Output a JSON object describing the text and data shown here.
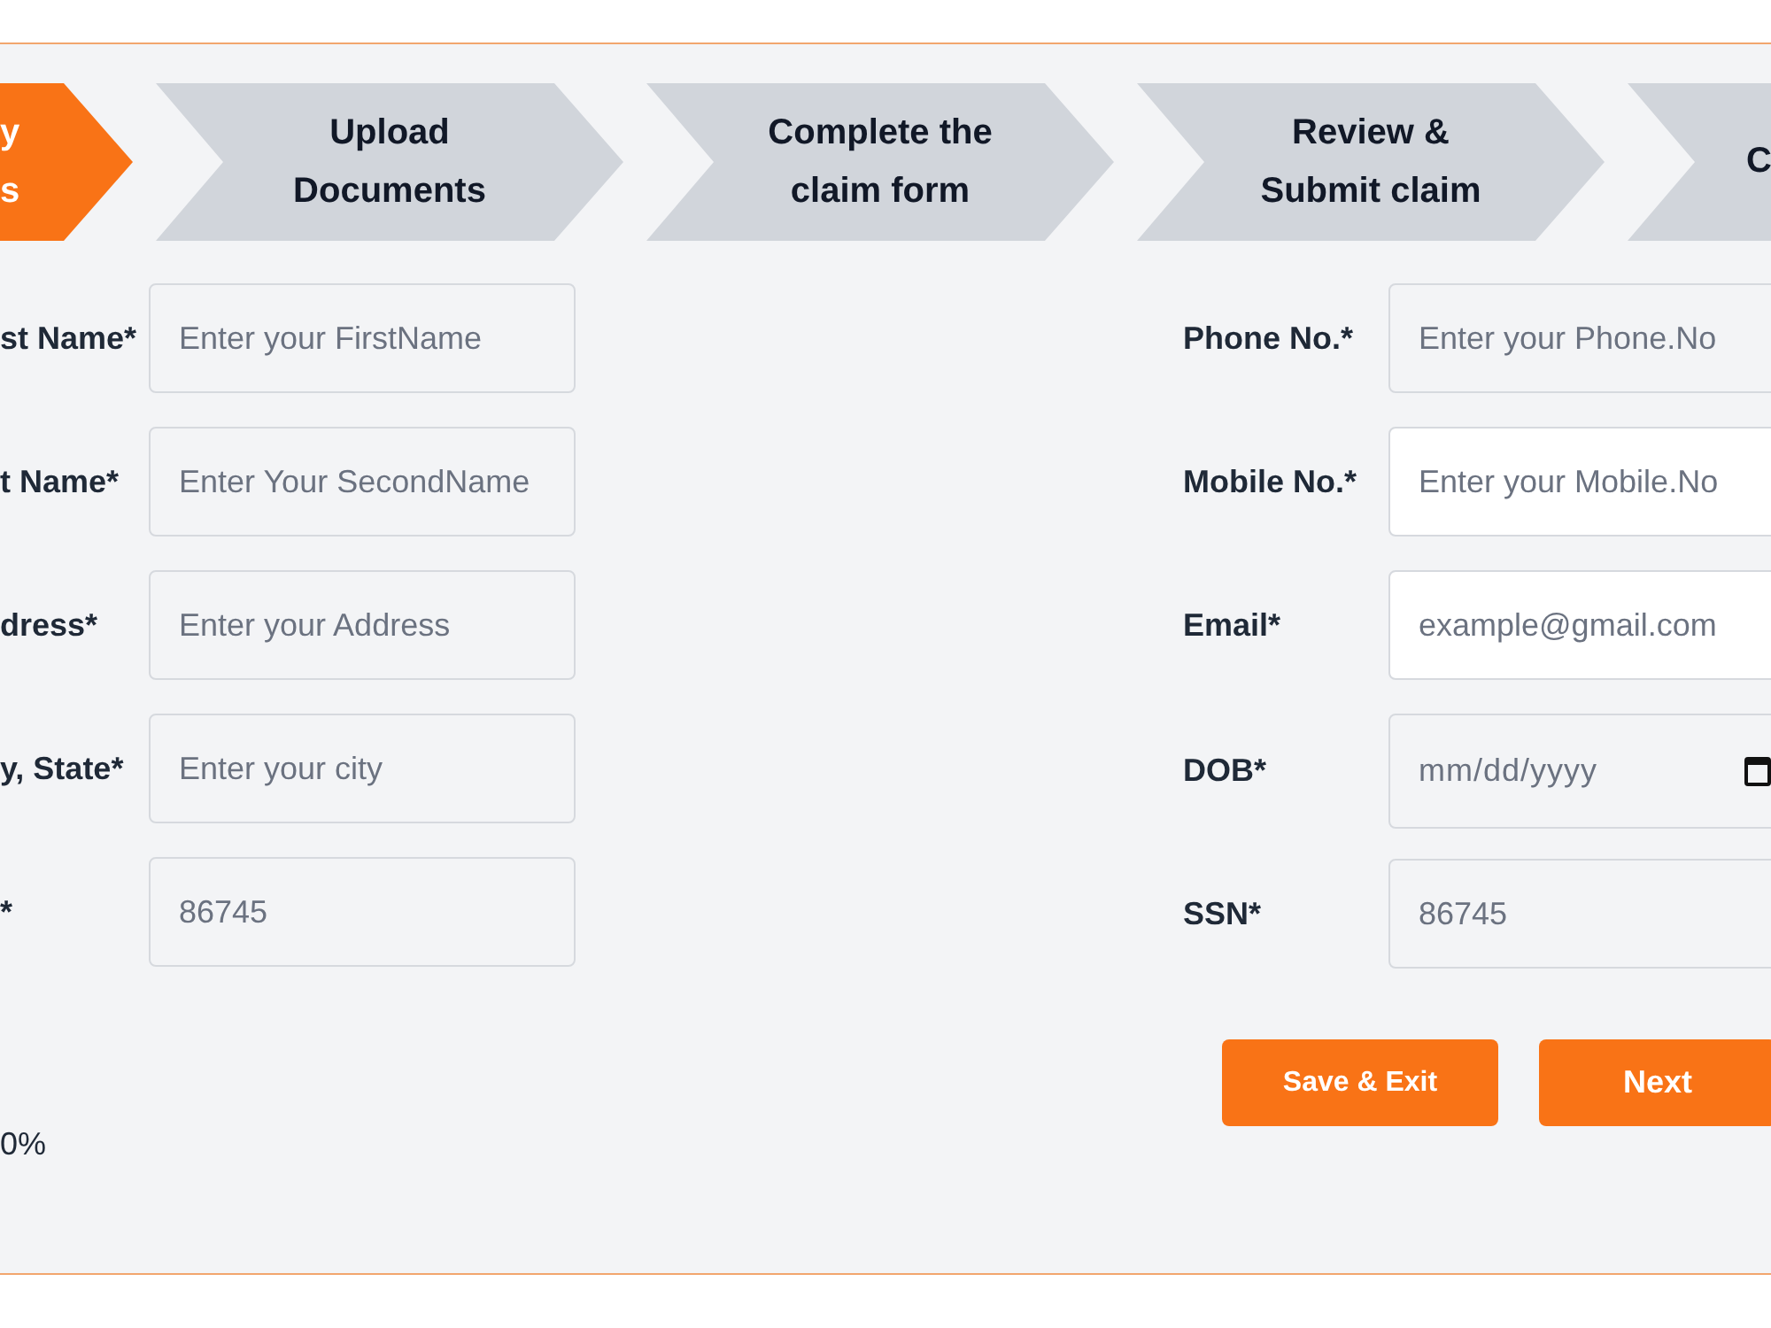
{
  "progress_steps": [
    {
      "lines": [
        "y",
        "s"
      ],
      "selected": true
    },
    {
      "lines": [
        "Upload",
        "Documents"
      ],
      "selected": false
    },
    {
      "lines": [
        "Complete the",
        "claim form"
      ],
      "selected": false
    },
    {
      "lines": [
        "Review &",
        "Submit claim"
      ],
      "selected": false
    },
    {
      "lines": [
        "C"
      ],
      "selected": false
    }
  ],
  "left_fields": [
    {
      "label": "st Name*",
      "placeholder": "Enter your FirstName",
      "shaded": true
    },
    {
      "label": "t Name*",
      "placeholder": "Enter Your SecondName",
      "shaded": true
    },
    {
      "label": "dress*",
      "placeholder": "Enter your Address",
      "shaded": true
    },
    {
      "label": "y, State*",
      "placeholder": "Enter your city",
      "shaded": true
    },
    {
      "label": "*",
      "placeholder": "86745",
      "shaded": true
    }
  ],
  "right_fields": [
    {
      "label": "Phone No.*",
      "kind": "text",
      "placeholder": "Enter your Phone.No",
      "shaded": true
    },
    {
      "label": "Mobile No.*",
      "kind": "text",
      "placeholder": "Enter your Mobile.No",
      "shaded": false
    },
    {
      "label": "Email*",
      "kind": "text",
      "placeholder": "example@gmail.com",
      "shaded": false
    },
    {
      "label": "DOB*",
      "kind": "date",
      "placeholder": "mm/dd/yyyy",
      "shaded": true
    },
    {
      "label": "SSN*",
      "kind": "text",
      "placeholder": "86745",
      "shaded": true
    }
  ],
  "progress_text": "0%",
  "buttons": [
    {
      "label": "Save & Exit",
      "kind": "save"
    },
    {
      "label": "Next",
      "kind": "next"
    }
  ]
}
